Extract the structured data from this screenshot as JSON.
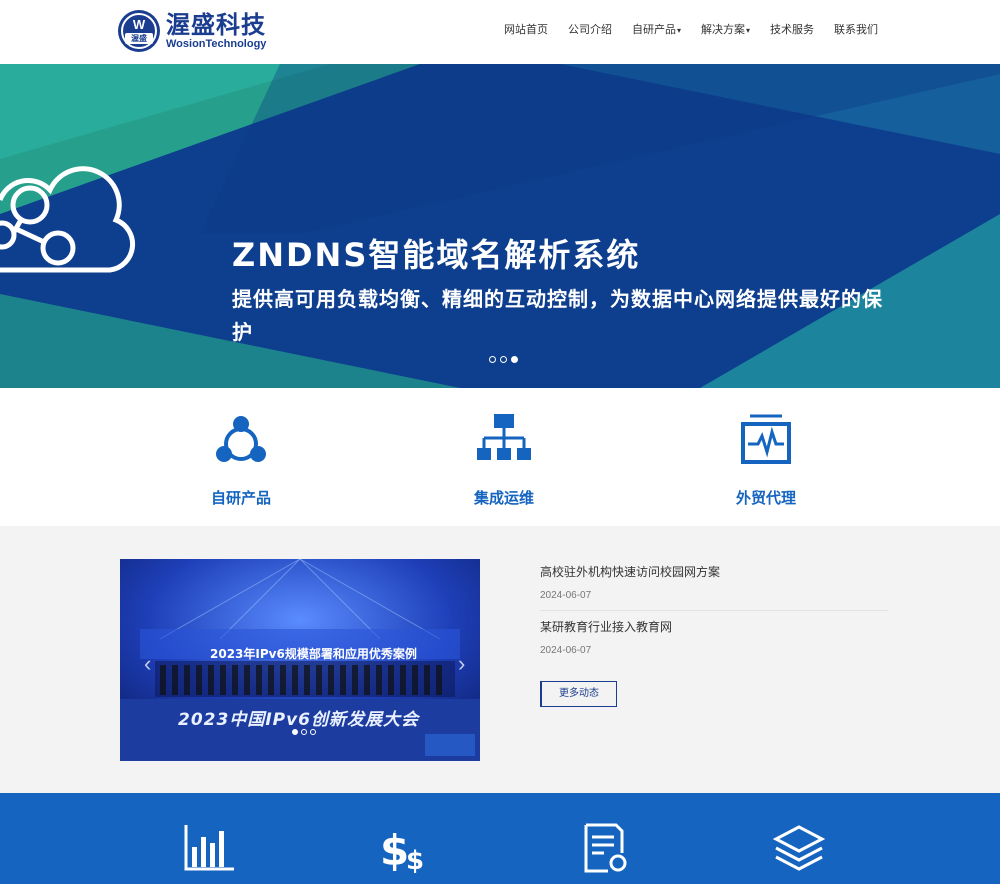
{
  "header": {
    "logo_cn": "渥盛科技",
    "logo_en": "WosionTechnology",
    "logo_mark_top": "W",
    "logo_mark_bottom": "渥盛",
    "nav": [
      {
        "label": "网站首页",
        "has_caret": false
      },
      {
        "label": "公司介绍",
        "has_caret": false
      },
      {
        "label": "自研产品",
        "has_caret": true
      },
      {
        "label": "解决方案",
        "has_caret": true
      },
      {
        "label": "技术服务",
        "has_caret": false
      },
      {
        "label": "联系我们",
        "has_caret": false
      }
    ],
    "caret": "▾"
  },
  "banner": {
    "title": "ZNDNS智能域名解析系统",
    "subtitle": "提供高可用负载均衡、精细的互动控制，为数据中心网络提供最好的保护",
    "active_dot": 2,
    "dot_count": 3
  },
  "features": [
    {
      "label": "自研产品",
      "icon": "network-nodes-icon"
    },
    {
      "label": "集成运维",
      "icon": "org-chart-icon"
    },
    {
      "label": "外贸代理",
      "icon": "monitor-pulse-icon"
    }
  ],
  "news": {
    "slider": {
      "title": "2023年IPv6规模部署和应用优秀案例",
      "caption": "2023中国IPv6创新发展大会",
      "prev": "‹",
      "next": "›",
      "active_dot": 0
    },
    "items": [
      {
        "title": "高校驻外机构快速访问校园网方案",
        "date": "2024-06-07"
      },
      {
        "title": "某研教育行业接入教育网",
        "date": "2024-06-07"
      }
    ],
    "more_label": "更多动态"
  },
  "band_icons": [
    "bar-chart-icon",
    "dollar-icon",
    "certificate-icon",
    "layers-icon"
  ],
  "colors": {
    "brand": "#1a3d8f",
    "accent": "#1565c0",
    "banner_bg": "#0e3f8e",
    "teal": "#2aa38f"
  }
}
